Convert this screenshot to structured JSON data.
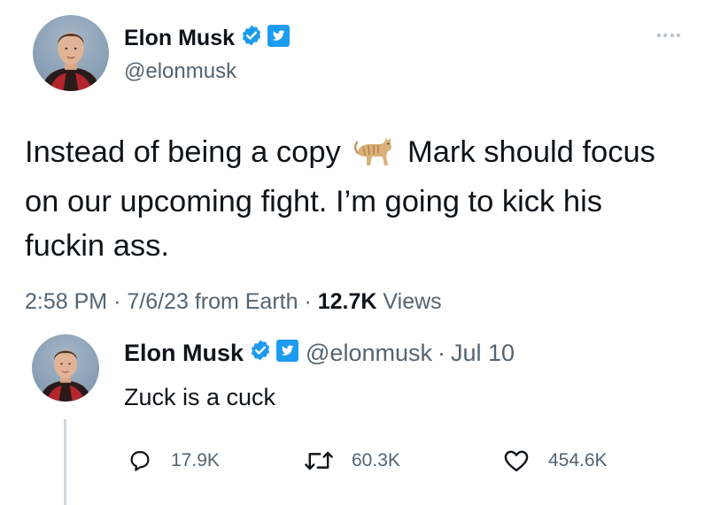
{
  "colors": {
    "verified_badge": "#1d9bf0",
    "text_primary": "#0f1419",
    "text_secondary": "#536471",
    "thread_line": "#cfd9de"
  },
  "tweet": {
    "author": {
      "name": "Elon Musk",
      "handle": "@elonmusk",
      "avatar_icon": "avatar-photo",
      "badges": [
        "verified-badge-icon",
        "twitter-logo-icon"
      ]
    },
    "text_before_emoji": "Instead of being a copy",
    "emoji_icon": "cat-icon",
    "text_after_emoji": "Mark should focus on our upcoming fight. I’m going to kick his fuckin ass.",
    "time": "2:58 PM",
    "separator": "·",
    "date": "7/6/23",
    "source": "from Earth",
    "views_count": "12.7K",
    "views_label": "Views"
  },
  "reply": {
    "author": {
      "name": "Elon Musk",
      "handle": "@elonmusk",
      "separator": "·",
      "date": "Jul 10",
      "avatar_icon": "avatar-photo",
      "badges": [
        "verified-badge-icon",
        "twitter-logo-icon"
      ]
    },
    "text": "Zuck is a cuck",
    "actions": {
      "replies": "17.9K",
      "retweets": "60.3K",
      "likes": "454.6K"
    }
  }
}
